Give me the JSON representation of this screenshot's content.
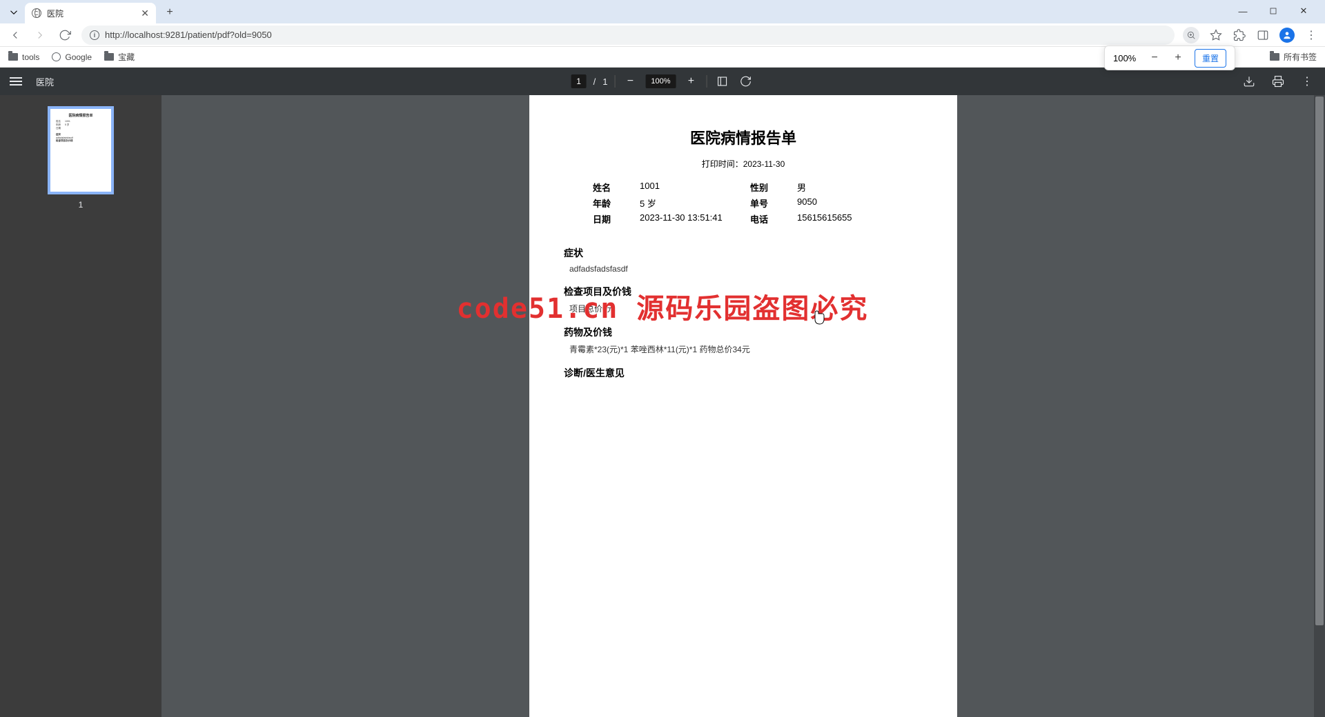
{
  "browser": {
    "tab_title": "医院",
    "url": "http://localhost:9281/patient/pdf?old=9050",
    "bookmarks": {
      "tools": "tools",
      "google": "Google",
      "treasure": "宝藏",
      "all": "所有书签"
    },
    "zoom_popup": {
      "pct": "100%",
      "reset": "重置"
    }
  },
  "pdf": {
    "title": "医院",
    "page_current": "1",
    "page_total": "1",
    "zoom": "100%",
    "thumb_label": "1"
  },
  "report": {
    "title": "医院病情报告单",
    "print_label": "打印时间：",
    "print_time": "2023-11-30",
    "labels": {
      "name": "姓名",
      "gender": "性别",
      "age": "年龄",
      "order_no": "单号",
      "date": "日期",
      "phone": "电话"
    },
    "values": {
      "name": "1001",
      "gender": "男",
      "age": "5 岁",
      "order_no": "9050",
      "date": "2023-11-30 13:51:41",
      "phone": "15615615655"
    },
    "sections": {
      "symptoms_h": "症状",
      "symptoms_v": "adfadsfadsfasdf",
      "exam_h": "检查项目及价钱",
      "exam_v": "项目总价0元",
      "meds_h": "药物及价钱",
      "meds_v": "青霉素*23(元)*1 苯唑西林*11(元)*1 药物总价34元",
      "diag_h": "诊断/医生意见"
    }
  },
  "watermark": {
    "small": "code51.cn",
    "big": "code51.cn 源码乐园盗图必究"
  }
}
